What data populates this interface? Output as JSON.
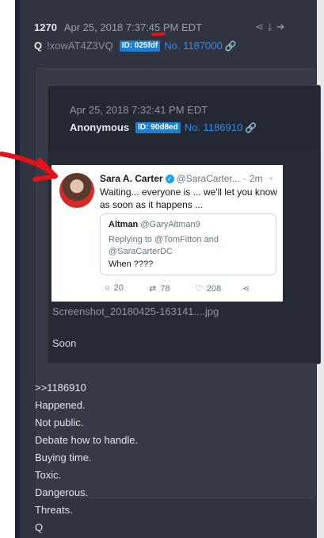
{
  "post": {
    "number": "1270",
    "date": "Apr 25, 2018 7:37:45 PM EDT",
    "tripcode": "!xowAT4Z3VQ",
    "q": "Q",
    "id_badge": "ID: 025fdf",
    "reply_link": "No. 1187000",
    "icons": [
      "share-icon",
      "download-icon",
      "arrow-right-circle-icon"
    ]
  },
  "quoted": {
    "date": "Apr 25, 2018 7:32:41 PM EDT",
    "name": "Anonymous",
    "id_badge": "ID: 90d8ed",
    "post_link": "No. 1186910",
    "filename": "Screenshot_20180425-163141....jpg",
    "body": "Soon"
  },
  "tweet": {
    "name": "Sara A. Carter",
    "handle": "@SaraCarter...",
    "time": "2m",
    "text": "Waiting... everyone is ... we'll let you know as soon as it happens ...",
    "quote": {
      "name": "Altman",
      "handle": "@GaryAltman9",
      "reply_to": "Replying to @TomFitton and @SaraCarterDC",
      "text": "When ????"
    },
    "replies": "20",
    "retweets": "78",
    "likes": "208"
  },
  "body_lines": [
    ">>1186910",
    "Happened.",
    "Not public.",
    "Debate how to handle.",
    "Buying time.",
    "Toxic.",
    "Dangerous.",
    "Threats.",
    "Q"
  ],
  "colors": {
    "background": "#2f3440",
    "link": "#2f8be6",
    "badge": "#1b7fd1",
    "annotation_red": "#e3121b"
  }
}
